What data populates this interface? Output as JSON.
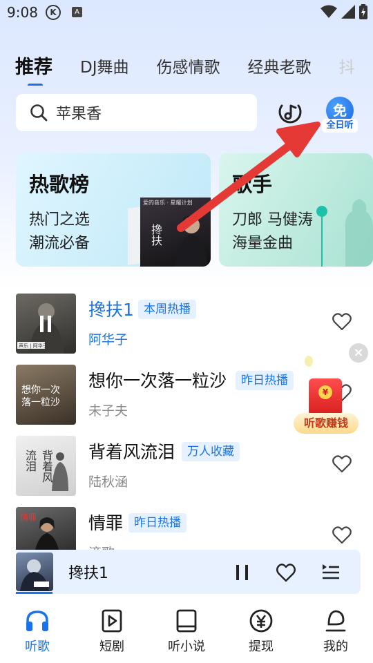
{
  "status_bar": {
    "time": "9:08",
    "k_icon": "K",
    "a_icon": "A"
  },
  "tabs": [
    {
      "label": "推荐",
      "active": true
    },
    {
      "label": "DJ舞曲"
    },
    {
      "label": "伤感情歌"
    },
    {
      "label": "经典老歌"
    },
    {
      "label": "抖"
    }
  ],
  "search": {
    "text": "苹果香"
  },
  "free_badge": {
    "icon_text": "免",
    "label": "全日听"
  },
  "cards": {
    "hot": {
      "title": "热歌榜",
      "line1": "热门之选",
      "line2": "潮流必备",
      "album_top": "爱的音乐 · 星耀计划",
      "album_script": "搀扶"
    },
    "singer": {
      "title": "歌手",
      "line1": "刀郎 马健涛",
      "line2": "海量金曲"
    }
  },
  "songs": [
    {
      "title": "搀扶1",
      "tag": "本周热播",
      "artist": "阿华子",
      "playing": true,
      "thumb_caption": "声乐 | 阿华子"
    },
    {
      "title": "想你一次落一粒沙",
      "tag": "昨日热播",
      "artist": "未子夫",
      "thumb_text": "想你一次 落一粒沙"
    },
    {
      "title": "背着风流泪",
      "tag": "万人收藏",
      "artist": "陆秋涵",
      "thumb_text": "背着风流泪"
    },
    {
      "title": "情罪",
      "tag": "昨日热播",
      "artist": "滴歌",
      "thumb_text": "情罪"
    }
  ],
  "promo": {
    "close": "×",
    "coin": "¥",
    "label": "听歌赚钱"
  },
  "player": {
    "title": "搀扶1"
  },
  "nav": [
    {
      "label": "听歌",
      "icon": "headphones-icon",
      "active": true
    },
    {
      "label": "短剧",
      "icon": "play-video-icon"
    },
    {
      "label": "听小说",
      "icon": "book-icon"
    },
    {
      "label": "提现",
      "icon": "yen-icon"
    },
    {
      "label": "我的",
      "icon": "user-icon"
    }
  ],
  "colors": {
    "accent": "#1a73e8",
    "arrow": "#e53935",
    "promo_red": "#d71e1e"
  }
}
